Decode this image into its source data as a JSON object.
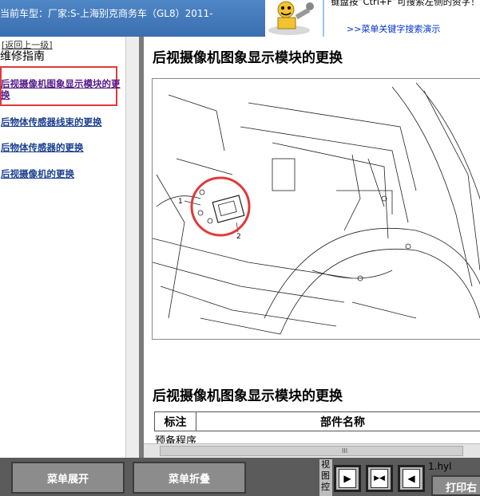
{
  "header": {
    "car_model": "当前车型：厂家:S-上海别克商务车（GL8）2011-",
    "hint_text": "键盘按“Ctrl+F”可搜索左侧的资字！",
    "hint_link": ">>菜单关键字搜索演示"
  },
  "sidebar": {
    "back_link": "[返回上一级]",
    "title": "维修指南",
    "items": [
      {
        "label": "后视摄像机图象显示模块的更换"
      },
      {
        "label": "后物体传感器线束的更换"
      },
      {
        "label": "后物体传感器的更换"
      },
      {
        "label": "后视摄像机的更换"
      }
    ]
  },
  "main": {
    "title": "后视摄像机图象显示模块的更换",
    "section_title": "后视摄像机图象显示模块的更换",
    "table_headers": [
      "标注",
      "部件名称"
    ],
    "pre_procedure": "预备程序",
    "scroll_grip": "III",
    "callouts": [
      "1",
      "2"
    ]
  },
  "bottom": {
    "expand_label": "菜单展开",
    "collapse_label": "菜单折叠",
    "view_label": "视图控",
    "file_label": "1.hyl",
    "print_label": "打印右"
  },
  "colors": {
    "header_bg": "#4a80c2",
    "highlight": "#e03a3a",
    "link": "#1b3f8f"
  }
}
